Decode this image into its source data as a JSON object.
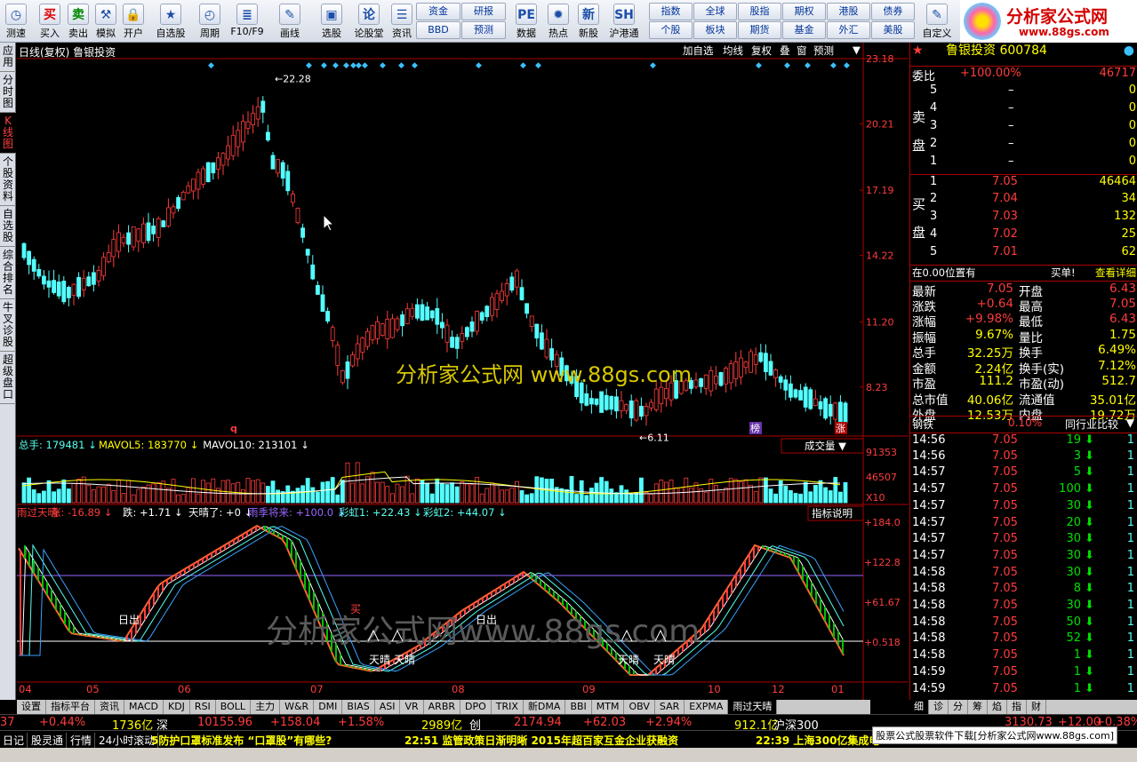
{
  "toolbar": {
    "buttons": [
      {
        "label": "测速",
        "icon": "clock-icon",
        "glyph": "◷"
      },
      {
        "label": "买入",
        "icon": "buy-icon",
        "glyph": "买"
      },
      {
        "label": "卖出",
        "icon": "sell-icon",
        "glyph": "卖"
      },
      {
        "label": "模拟",
        "icon": "gavel-icon",
        "glyph": "⚒"
      },
      {
        "label": "开户",
        "icon": "lock-icon",
        "glyph": "🔒"
      },
      {
        "label": "自选股",
        "icon": "star-icon",
        "glyph": "★"
      },
      {
        "label": "周期",
        "icon": "cycle-icon",
        "glyph": "◴"
      },
      {
        "label": "F10/F9",
        "icon": "f10-icon",
        "glyph": "≣"
      },
      {
        "label": "画线",
        "icon": "pen-icon",
        "glyph": "✎"
      },
      {
        "label": "选股",
        "icon": "screen-icon",
        "glyph": "▣"
      },
      {
        "label": "论股堂",
        "icon": "chat-icon",
        "glyph": "论"
      },
      {
        "label": "资讯",
        "icon": "news-icon",
        "glyph": "☰"
      },
      {
        "label": "数据",
        "icon": "pe-icon",
        "glyph": "PE"
      },
      {
        "label": "热点",
        "icon": "fire-icon",
        "glyph": "✹"
      },
      {
        "label": "新股",
        "icon": "newstock-icon",
        "glyph": "新"
      },
      {
        "label": "沪港通",
        "icon": "hk-connect-icon",
        "glyph": "SH"
      },
      {
        "label": "自定义",
        "icon": "custom-icon",
        "glyph": "✎"
      }
    ],
    "grid1": [
      "资金",
      "研报",
      "BBD",
      "预测"
    ],
    "grid2": [
      "指数",
      "全球",
      "股指",
      "期权",
      "港股",
      "债券",
      "个股",
      "板块",
      "期货",
      "基金",
      "外汇",
      "美股"
    ]
  },
  "logo": {
    "name": "分析家公式网",
    "url": "www.88gs.com"
  },
  "sidetabs": [
    "应用",
    "分时图",
    "K线图",
    "个股资料",
    "自选股",
    "综合排名",
    "牛叉诊股",
    "超级盘口"
  ],
  "chart": {
    "title": "日线(复权) 鲁银投资",
    "header_buttons": [
      "加自选",
      "均线",
      "复权",
      "叠",
      "窗",
      "预测"
    ],
    "price_axis": [
      "23.18",
      "20.21",
      "17.19",
      "14.22",
      "11.20",
      "8.23"
    ],
    "hi_label": "22.28",
    "lo_label": "6.11",
    "watermark": "分析家公式网 www.88gs.com",
    "watermark2": "分析家公式网www.88gs.com",
    "markers": {
      "q": "q",
      "bang": "榜",
      "zhang": "涨"
    },
    "volume": {
      "legend": [
        {
          "t": "总手: 179481",
          "c": "#5fe"
        },
        {
          "t": "MAVOL5: 183770",
          "c": "#ffff00"
        },
        {
          "t": "MAVOL10: 213101",
          "c": "#fff"
        }
      ],
      "axis": [
        "91353",
        "46507",
        "X10"
      ],
      "dropdown": "成交量"
    },
    "indicator": {
      "legend": [
        {
          "t": "雨过天晴",
          "c": "#ff3c3c"
        },
        {
          "t": "涨: -16.89",
          "c": "#ff3c3c"
        },
        {
          "t": "跌: +1.71",
          "c": "#fff"
        },
        {
          "t": "天晴了: +0",
          "c": "#fff"
        },
        {
          "t": "雨季将来: +100.0",
          "c": "#9966ff"
        },
        {
          "t": "彩虹1: +22.43",
          "c": "#5fe"
        },
        {
          "t": "彩虹2: +44.07",
          "c": "#5fe"
        }
      ],
      "axis": [
        "+184.0",
        "+122.8",
        "+61.67",
        "+0.518"
      ],
      "button": "指标说明",
      "labels": [
        "日出",
        "日出",
        "天晴",
        "天晴",
        "天晴",
        "天晴",
        "买"
      ]
    },
    "xaxis": [
      "04",
      "05",
      "06",
      "07",
      "08",
      "09",
      "10",
      "12",
      "01"
    ],
    "chart_data": {
      "type": "candlestick",
      "high": 22.28,
      "low": 6.11,
      "ylim": [
        6.0,
        23.18
      ],
      "ma_lines": [
        "MAVOL5",
        "MAVOL10"
      ]
    }
  },
  "bottom_tabs": [
    "设置",
    "指标平台",
    "资讯",
    "MACD",
    "KDJ",
    "RSI",
    "BOLL",
    "主力",
    "W&R",
    "DMI",
    "BIAS",
    "ASI",
    "VR",
    "ARBR",
    "DPO",
    "TRIX",
    "新DMA",
    "BBI",
    "MTM",
    "OBV",
    "SAR",
    "EXPMA",
    "雨过天晴"
  ],
  "quote": {
    "name": "鲁银投资 600784",
    "weibi_label": "委比",
    "weibi": "+100.00%",
    "weicha": "46717",
    "sell_label": "卖盘",
    "buy_label": "买盘",
    "sells": [
      {
        "n": "5",
        "p": "–",
        "v": "0"
      },
      {
        "n": "4",
        "p": "–",
        "v": "0"
      },
      {
        "n": "3",
        "p": "–",
        "v": "0"
      },
      {
        "n": "2",
        "p": "–",
        "v": "0"
      },
      {
        "n": "1",
        "p": "–",
        "v": "0"
      }
    ],
    "buys": [
      {
        "n": "1",
        "p": "7.05",
        "v": "46464"
      },
      {
        "n": "2",
        "p": "7.04",
        "v": "34"
      },
      {
        "n": "3",
        "p": "7.03",
        "v": "132"
      },
      {
        "n": "4",
        "p": "7.02",
        "v": "25"
      },
      {
        "n": "5",
        "p": "7.01",
        "v": "62"
      }
    ],
    "pos_line": "在0.00位置有",
    "buy_order": "买单!",
    "detail": "查看详细",
    "stats": [
      [
        "最新",
        "7.05",
        "开盘",
        "6.43"
      ],
      [
        "涨跌",
        "+0.64",
        "最高",
        "7.05"
      ],
      [
        "涨幅",
        "+9.98%",
        "最低",
        "6.43"
      ],
      [
        "振幅",
        "9.67%",
        "量比",
        "1.75"
      ],
      [
        "总手",
        "32.25万",
        "换手",
        "6.49%"
      ],
      [
        "金额",
        "2.24亿",
        "换手(实)",
        "7.12%"
      ],
      [
        "市盈",
        "111.2",
        "市盈(动)",
        "512.7"
      ],
      [
        "总市值",
        "40.06亿",
        "流通值",
        "35.01亿"
      ],
      [
        "外盘",
        "12.53万",
        "内盘",
        "19.72万"
      ]
    ],
    "industry": "钢铁",
    "industry_pct": "0.10%",
    "industry_cmp": "同行业比较",
    "ticks": [
      {
        "t": "14:56",
        "p": "7.05",
        "v": "19"
      },
      {
        "t": "14:56",
        "p": "7.05",
        "v": "3"
      },
      {
        "t": "14:57",
        "p": "7.05",
        "v": "5"
      },
      {
        "t": "14:57",
        "p": "7.05",
        "v": "100"
      },
      {
        "t": "14:57",
        "p": "7.05",
        "v": "30"
      },
      {
        "t": "14:57",
        "p": "7.05",
        "v": "20"
      },
      {
        "t": "14:57",
        "p": "7.05",
        "v": "30"
      },
      {
        "t": "14:57",
        "p": "7.05",
        "v": "30"
      },
      {
        "t": "14:58",
        "p": "7.05",
        "v": "30"
      },
      {
        "t": "14:58",
        "p": "7.05",
        "v": "8"
      },
      {
        "t": "14:58",
        "p": "7.05",
        "v": "30"
      },
      {
        "t": "14:58",
        "p": "7.05",
        "v": "50"
      },
      {
        "t": "14:58",
        "p": "7.05",
        "v": "52"
      },
      {
        "t": "14:58",
        "p": "7.05",
        "v": "1"
      },
      {
        "t": "14:59",
        "p": "7.05",
        "v": "1"
      },
      {
        "t": "14:59",
        "p": "7.05",
        "v": "1"
      }
    ],
    "right_tabs": [
      "细",
      "诊",
      "分",
      "筹",
      "焰",
      "指",
      "财"
    ]
  },
  "index_bar": [
    {
      "t": "37",
      "c": "#ff3c3c"
    },
    {
      "t": "+0.44%",
      "c": "#ff3c3c"
    },
    {
      "t": "1736亿",
      "c": "#ffff00"
    },
    {
      "t": "深",
      "c": "#fff"
    },
    {
      "t": "10155.96",
      "c": "#ff3c3c"
    },
    {
      "t": "+158.04",
      "c": "#ff3c3c"
    },
    {
      "t": "+1.58%",
      "c": "#ff3c3c"
    },
    {
      "t": "2989亿",
      "c": "#ffff00"
    },
    {
      "t": "创",
      "c": "#fff"
    },
    {
      "t": "2174.94",
      "c": "#ff3c3c"
    },
    {
      "t": "+62.03",
      "c": "#ff3c3c"
    },
    {
      "t": "+2.94%",
      "c": "#ff3c3c"
    },
    {
      "t": "912.1亿",
      "c": "#ffff00"
    },
    {
      "t": "沪深300",
      "c": "#fff"
    },
    {
      "t": "3130.73",
      "c": "#ff3c3c"
    },
    {
      "t": "+12.00",
      "c": "#ff3c3c"
    },
    {
      "t": "+0.38%",
      "c": "#ff3c3c"
    }
  ],
  "news": {
    "left": [
      "日记",
      "股灵通",
      "行情",
      "24小时滚动"
    ],
    "items": [
      "5防护口罩标准发布 “口罩股”有哪些?",
      "22:51 监管政策日渐明晰 2015年超百家互金企业获融资",
      "22:39 上海300亿集成电"
    ],
    "download": "股票公式股票软件下载[分析家公式网www.88gs.com]"
  }
}
